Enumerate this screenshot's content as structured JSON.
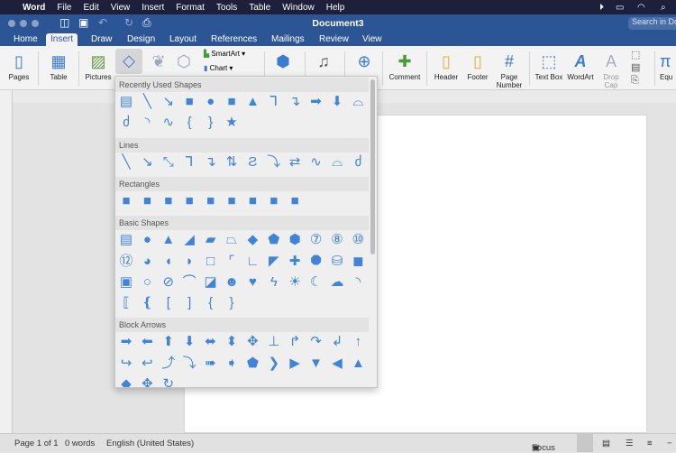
{
  "menubar": {
    "app": "Word",
    "items": [
      "File",
      "Edit",
      "View",
      "Insert",
      "Format",
      "Tools",
      "Table",
      "Window",
      "Help"
    ]
  },
  "titlebar": {
    "title": "Document3",
    "search_placeholder": "Search in Document"
  },
  "tabs": [
    {
      "label": "Home"
    },
    {
      "label": "Insert",
      "active": true
    },
    {
      "label": "Draw"
    },
    {
      "label": "Design"
    },
    {
      "label": "Layout"
    },
    {
      "label": "References"
    },
    {
      "label": "Mailings"
    },
    {
      "label": "Review"
    },
    {
      "label": "View"
    }
  ],
  "ribbon": {
    "pages": "Pages",
    "table": "Table",
    "pictures": "Pictures",
    "smartart": "SmartArt",
    "chart": "Chart",
    "comment": "Comment",
    "header": "Header",
    "footer": "Footer",
    "page_number": "Page Number",
    "text_box": "Text Box",
    "wordart": "WordArt",
    "drop_cap": "Drop Cap",
    "equation": "Equ"
  },
  "shapes_panel": {
    "sections": [
      {
        "title": "Recently Used Shapes",
        "shapes": [
          "text-box",
          "line",
          "arrow-line",
          "rectangle",
          "oval",
          "rounded-rectangle",
          "triangle",
          "elbow-connector",
          "elbow-arrow-connector",
          "right-arrow",
          "down-arrow",
          "freeform",
          "scribble",
          "arc",
          "wave-curve",
          "left-brace",
          "right-brace",
          "star"
        ]
      },
      {
        "title": "Lines",
        "shapes": [
          "line",
          "arrow-line",
          "double-arrow-line",
          "elbow-connector",
          "elbow-arrow-connector",
          "elbow-double-arrow-connector",
          "curved-connector",
          "curved-arrow-connector",
          "curved-double-arrow-connector",
          "curve",
          "freeform",
          "scribble"
        ]
      },
      {
        "title": "Rectangles",
        "shapes": [
          "rectangle",
          "rounded-rectangle",
          "snip-single-corner",
          "snip-same-side",
          "snip-diagonal",
          "snip-round",
          "round-single-corner",
          "round-same-side",
          "round-diagonal"
        ]
      },
      {
        "title": "Basic Shapes",
        "shapes": [
          "text-box",
          "oval",
          "triangle",
          "right-triangle",
          "parallelogram",
          "trapezoid",
          "diamond",
          "pentagon",
          "hexagon",
          "heptagon",
          "octagon",
          "decagon",
          "dodecagon",
          "pie",
          "chord",
          "teardrop",
          "frame",
          "half-frame",
          "l-shape",
          "diagonal-stripe",
          "cross",
          "plaque",
          "can",
          "cube",
          "bevel",
          "donut",
          "no-symbol",
          "block-arc",
          "folded-corner",
          "smiley-face",
          "heart",
          "lightning-bolt",
          "sun",
          "moon",
          "cloud",
          "arc",
          "double-bracket",
          "double-brace",
          "left-bracket",
          "right-bracket",
          "left-brace",
          "right-brace"
        ]
      },
      {
        "title": "Block Arrows",
        "shapes": [
          "right-arrow",
          "left-arrow",
          "up-arrow",
          "down-arrow",
          "left-right-arrow",
          "up-down-arrow",
          "quad-arrow",
          "left-right-up-arrow",
          "bent-arrow",
          "u-turn-arrow",
          "left-up-arrow",
          "bent-up-arrow",
          "curved-right-arrow",
          "curved-left-arrow",
          "curved-up-arrow",
          "curved-down-arrow",
          "striped-right-arrow",
          "notched-right-arrow",
          "pentagon-arrow",
          "chevron",
          "right-arrow-callout",
          "down-arrow-callout",
          "left-arrow-callout",
          "up-arrow-callout",
          "left-right-arrow-callout",
          "quad-arrow-callout",
          "circular-arrow"
        ]
      }
    ]
  },
  "status": {
    "page": "Page 1 of 1",
    "words": "0 words",
    "language": "English (United States)",
    "focus": "Focus"
  },
  "colors": {
    "accent": "#2c5596",
    "shape": "#3f84d8",
    "menubar": "#1d1f3b"
  }
}
